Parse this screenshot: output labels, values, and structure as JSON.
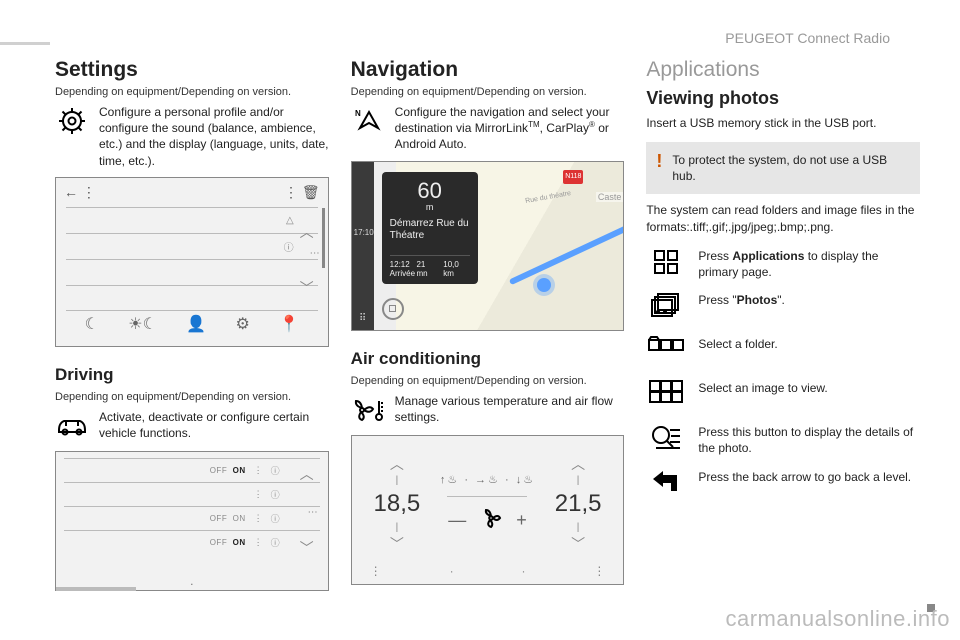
{
  "header": {
    "product": "PEUGEOT Connect Radio"
  },
  "watermark": "carmanualsonline.info",
  "common": {
    "depending": "Depending on equipment/Depending on version."
  },
  "col1": {
    "settings_title": "Settings",
    "settings_desc": "Configure a personal profile and/or configure the sound (balance, ambience, etc.) and the display (language, units, date, time, etc.).",
    "driving_title": "Driving",
    "driving_desc": "Activate, deactivate or configure certain vehicle functions."
  },
  "col2": {
    "nav_title": "Navigation",
    "nav_desc_pre": "Configure the navigation and select your destination via MirrorLink",
    "nav_desc_tm": "TM",
    "nav_desc_mid": ", CarPlay",
    "nav_desc_reg": "®",
    "nav_desc_post": " or Android Auto.",
    "ac_title": "Air conditioning",
    "ac_desc": "Manage various temperature and air flow settings.",
    "nav_shot": {
      "dist": "60",
      "dist_unit": "m",
      "direction": "Démarrez Rue du Théatre",
      "eta_t": "12:12",
      "eta_l": "Arrivée",
      "min_t": "21",
      "min_l": "mn",
      "km_t": "10,0",
      "km_l": "km",
      "time": "17:10",
      "sign": "N118",
      "road": "Rue du théatre",
      "cast": "Caste"
    },
    "ac_shot": {
      "left": "18,5",
      "right": "21,5"
    }
  },
  "col3": {
    "apps_title": "Applications",
    "view_title": "Viewing photos",
    "insert": "Insert a USB memory stick in the USB port.",
    "warn": "To protect the system, do not use a USB hub.",
    "formats": "The system can read folders and image files in the formats:.tiff;.gif;.jpg/jpeg;.bmp;.png.",
    "step1_pre": "Press ",
    "step1_bold": "Applications",
    "step1_post": " to display the primary page.",
    "step2_pre": "Press \"",
    "step2_bold": "Photos",
    "step2_post": "\".",
    "step3": "Select a folder.",
    "step4": "Select an image to view.",
    "step5": "Press this button to display the details of the photo.",
    "step6": "Press the back arrow to go back a level."
  },
  "shot2_labels": {
    "off": "OFF",
    "on": "ON"
  }
}
